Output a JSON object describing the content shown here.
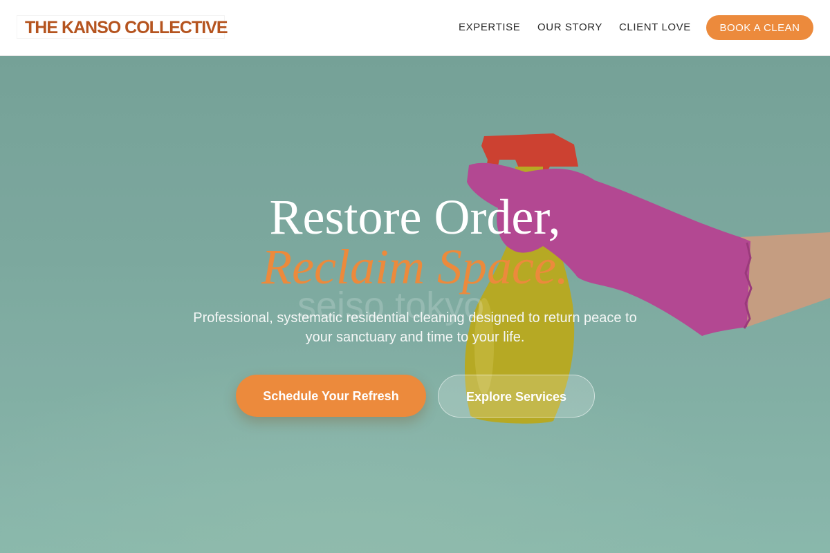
{
  "header": {
    "logo": "THE KANSO COLLECTIVE",
    "nav": [
      {
        "label": "EXPERTISE"
      },
      {
        "label": "OUR STORY"
      },
      {
        "label": "CLIENT LOVE"
      }
    ],
    "book_label": "BOOK A CLEAN"
  },
  "hero": {
    "headline_line1": "Restore Order,",
    "headline_line2": "Reclaim Space.",
    "watermark": "seiso tokyo",
    "subtext": "Professional, systematic residential cleaning designed to return peace to your sanctuary and time to your life.",
    "primary_cta": "Schedule Your Refresh",
    "secondary_cta": "Explore Services",
    "image_description_icon": "spray-bottle-gloved-hand-image"
  },
  "colors": {
    "accent": "#ec8a3c",
    "logo": "#b5541f",
    "hero_bg": "#86b1a7",
    "glove": "#c2449a",
    "bottle": "#c9b51c",
    "trigger": "#e33a2a"
  }
}
